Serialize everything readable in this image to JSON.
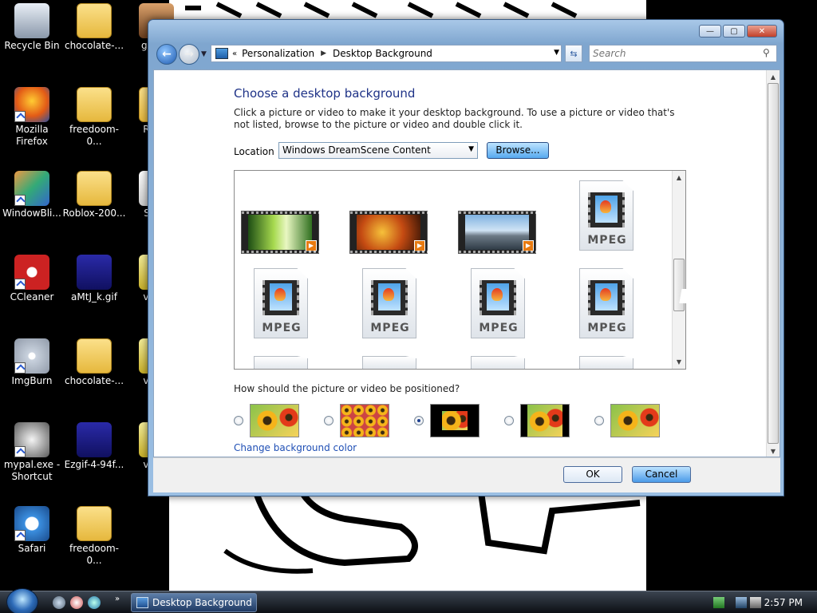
{
  "desktop": {
    "icons": [
      {
        "label": "Recycle Bin",
        "name": "recycle-bin-icon"
      },
      {
        "label": "chocolate-...",
        "name": "folder-icon"
      },
      {
        "label": "guy-...",
        "name": "image-file-icon"
      },
      {
        "label": "Mozilla Firefox",
        "name": "firefox-icon"
      },
      {
        "label": "freedoom-0...",
        "name": "folder-icon"
      },
      {
        "label": "Roblo",
        "name": "folder-icon"
      },
      {
        "label": "WindowBli...",
        "name": "windowblinds-icon"
      },
      {
        "label": "Roblox-200...",
        "name": "folder-icon"
      },
      {
        "label": "Safar",
        "name": "file-icon"
      },
      {
        "label": "CCleaner",
        "name": "ccleaner-icon"
      },
      {
        "label": "aMtJ_k.gif",
        "name": "gif-file-icon"
      },
      {
        "label": "vcred",
        "name": "installer-icon"
      },
      {
        "label": "ImgBurn",
        "name": "imgburn-icon"
      },
      {
        "label": "chocolate-...",
        "name": "folder-icon"
      },
      {
        "label": "vcred",
        "name": "installer-icon"
      },
      {
        "label": "mypal.exe - Shortcut",
        "name": "mypal-icon"
      },
      {
        "label": "Ezgif-4-94f...",
        "name": "gif-file-icon"
      },
      {
        "label": "vcred",
        "name": "installer-icon"
      },
      {
        "label": "Safari",
        "name": "safari-icon"
      },
      {
        "label": "freedoom-0...",
        "name": "folder-icon"
      }
    ]
  },
  "window": {
    "controls": {
      "minimize": "—",
      "maximize": "▢",
      "close": "✕"
    },
    "breadcrumb": [
      "Personalization",
      "Desktop Background"
    ],
    "search_placeholder": "Search",
    "heading": "Choose a desktop background",
    "description": "Click a picture or video to make it your desktop background. To use a picture or video that's not listed, browse to the picture or video and double click it.",
    "location_label": "Location",
    "location_value": "Windows DreamScene Content",
    "browse_label": "Browse...",
    "mpeg_label": "MPEG",
    "position_question": "How should the picture or video be positioned?",
    "position_selected_index": 2,
    "change_color_label": "Change background color",
    "ok_label": "OK",
    "cancel_label": "Cancel"
  },
  "taskbar": {
    "active_task": "Desktop Background",
    "clock": "2:57 PM"
  }
}
